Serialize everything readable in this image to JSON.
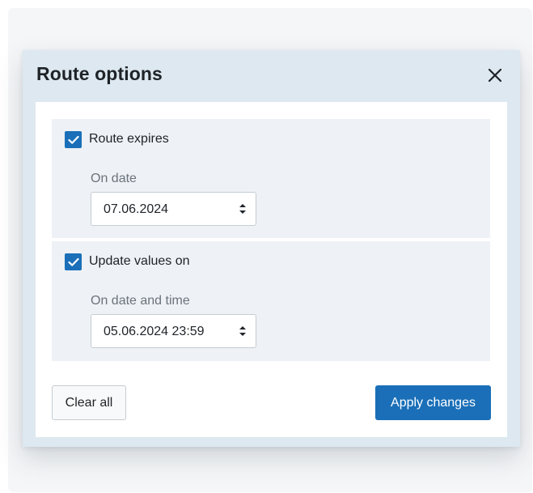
{
  "dialog": {
    "title": "Route options",
    "close_icon": "close-icon"
  },
  "sections": [
    {
      "checkbox_checked": true,
      "checkbox_label": "Route expires",
      "field_label": "On date",
      "field_value": "07.06.2024",
      "stepper_icon": "stepper-icon"
    },
    {
      "checkbox_checked": true,
      "checkbox_label": "Update values on",
      "field_label": "On date and time",
      "field_value": "05.06.2024 23:59",
      "stepper_icon": "stepper-icon"
    }
  ],
  "footer": {
    "clear_label": "Clear all",
    "apply_label": "Apply changes"
  },
  "colors": {
    "accent": "#1a6fb8",
    "header_bg": "#dde8f0",
    "section_bg": "#eef1f5"
  }
}
